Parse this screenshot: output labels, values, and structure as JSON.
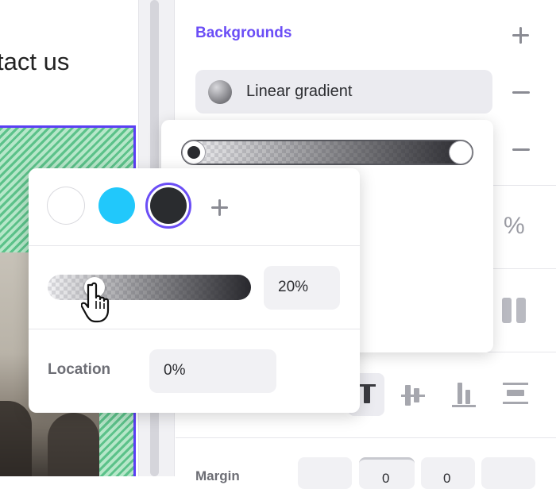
{
  "canvas": {
    "heading_fragment": "tact us"
  },
  "panel": {
    "backgrounds_title": "Backgrounds",
    "background_item": {
      "label": "Linear gradient",
      "type": "linear-gradient"
    },
    "margin_label": "Margin",
    "margin_values": [
      "0",
      "0"
    ]
  },
  "gradient_editor": {
    "stops": [
      {
        "position_fraction": 0.0,
        "color": "#2a2b2f"
      },
      {
        "position_fraction": 1.0,
        "color": "#ffffff"
      }
    ]
  },
  "color_stop_popup": {
    "swatches": [
      {
        "name": "white",
        "color": "#ffffff",
        "selected": false
      },
      {
        "name": "blue",
        "color": "#21c8fb",
        "selected": false
      },
      {
        "name": "dark",
        "color": "#2a2c2f",
        "selected": true
      }
    ],
    "opacity_value": "20%",
    "opacity_fraction": 0.2,
    "location_label": "Location",
    "location_value": "0%"
  },
  "colors": {
    "accent": "#6b4ef6",
    "selection_outline": "#5b3ff4",
    "icon_grey": "#8a8b93"
  },
  "icons": [
    "plus-icon",
    "minus-icon",
    "linear-gradient-icon",
    "radial-gradient-icon",
    "percent-icon",
    "arrow-down-icon",
    "pause-icon",
    "align-top-icon",
    "align-middle-icon",
    "align-bottom-icon",
    "distribute-icon",
    "hand-cursor-icon"
  ]
}
